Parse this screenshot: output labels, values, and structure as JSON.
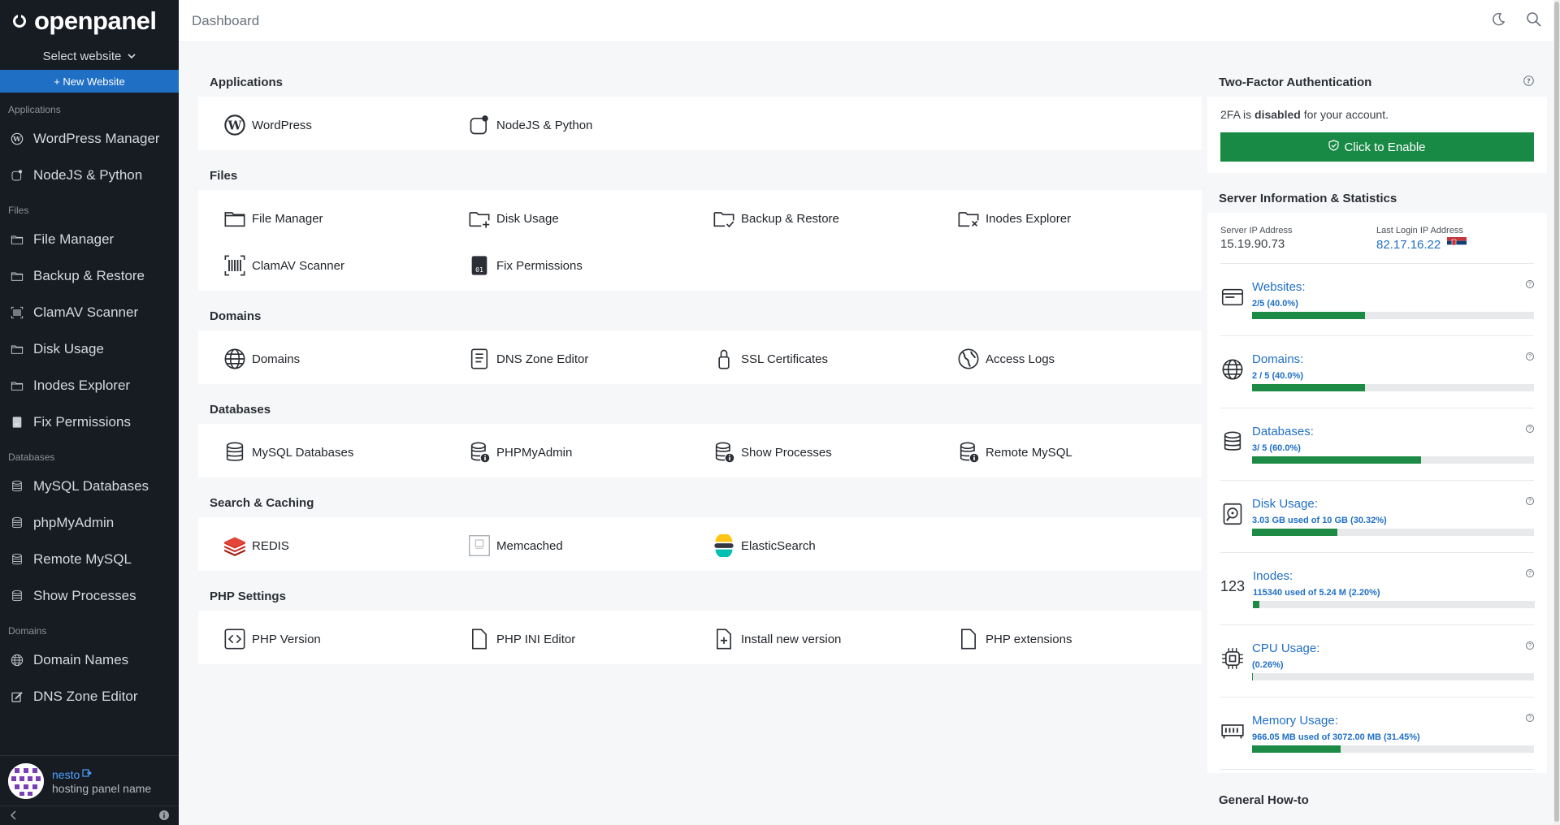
{
  "brand": {
    "logo_text": "openpanel"
  },
  "sidebar": {
    "select_website": "Select website",
    "new_website": "+ New Website",
    "sections": [
      {
        "title": "Applications",
        "items": [
          {
            "label": "WordPress Manager",
            "icon": "wordpress-icon"
          },
          {
            "label": "NodeJS & Python",
            "icon": "nodejs-icon"
          }
        ]
      },
      {
        "title": "Files",
        "items": [
          {
            "label": "File Manager",
            "icon": "folder-icon"
          },
          {
            "label": "Backup & Restore",
            "icon": "folder-icon"
          },
          {
            "label": "ClamAV Scanner",
            "icon": "barcode-icon"
          },
          {
            "label": "Disk Usage",
            "icon": "folder-icon"
          },
          {
            "label": "Inodes Explorer",
            "icon": "folder-icon"
          },
          {
            "label": "Fix Permissions",
            "icon": "file-lock-icon"
          }
        ]
      },
      {
        "title": "Databases",
        "items": [
          {
            "label": "MySQL Databases",
            "icon": "database-icon"
          },
          {
            "label": "phpMyAdmin",
            "icon": "database-icon"
          },
          {
            "label": "Remote MySQL",
            "icon": "database-icon"
          },
          {
            "label": "Show Processes",
            "icon": "database-icon"
          }
        ]
      },
      {
        "title": "Domains",
        "items": [
          {
            "label": "Domain Names",
            "icon": "globe-icon"
          },
          {
            "label": "DNS Zone Editor",
            "icon": "edit-icon"
          }
        ]
      }
    ],
    "user": {
      "name": "nesto",
      "subtitle": "hosting panel name"
    }
  },
  "header": {
    "breadcrumb": "Dashboard"
  },
  "main": {
    "sections": [
      {
        "title": "Applications",
        "items": [
          {
            "label": "WordPress",
            "icon": "wordpress-icon"
          },
          {
            "label": "NodeJS & Python",
            "icon": "nodejs-icon"
          }
        ]
      },
      {
        "title": "Files",
        "items": [
          {
            "label": "File Manager",
            "icon": "folder-icon"
          },
          {
            "label": "Disk Usage",
            "icon": "folder-plus-icon"
          },
          {
            "label": "Backup & Restore",
            "icon": "folder-check-icon"
          },
          {
            "label": "Inodes Explorer",
            "icon": "folder-x-icon"
          },
          {
            "label": "ClamAV Scanner",
            "icon": "barcode-scan-icon"
          },
          {
            "label": "Fix Permissions",
            "icon": "binary-file-icon"
          }
        ]
      },
      {
        "title": "Domains",
        "items": [
          {
            "label": "Domains",
            "icon": "globe-icon"
          },
          {
            "label": "DNS Zone Editor",
            "icon": "document-icon"
          },
          {
            "label": "SSL Certificates",
            "icon": "lock-icon"
          },
          {
            "label": "Access Logs",
            "icon": "globe-pin-icon"
          }
        ]
      },
      {
        "title": "Databases",
        "items": [
          {
            "label": "MySQL Databases",
            "icon": "database-icon"
          },
          {
            "label": "PHPMyAdmin",
            "icon": "database-info-icon"
          },
          {
            "label": "Show Processes",
            "icon": "database-off-icon"
          },
          {
            "label": "Remote MySQL",
            "icon": "database-remote-icon"
          }
        ]
      },
      {
        "title": "Search & Caching",
        "items": [
          {
            "label": "REDIS",
            "icon": "redis-icon"
          },
          {
            "label": "Memcached",
            "icon": "memcached-icon"
          },
          {
            "label": "ElasticSearch",
            "icon": "elasticsearch-icon"
          }
        ]
      },
      {
        "title": "PHP Settings",
        "items": [
          {
            "label": "PHP Version",
            "icon": "code-file-icon"
          },
          {
            "label": "PHP INI Editor",
            "icon": "file-icon"
          },
          {
            "label": "Install new version",
            "icon": "file-plus-icon"
          },
          {
            "label": "PHP extensions",
            "icon": "file-icon"
          }
        ]
      }
    ]
  },
  "tfa": {
    "title": "Two-Factor Authentication",
    "text_prefix": "2FA is ",
    "text_bold": "disabled",
    "text_suffix": " for your account.",
    "button": "Click to Enable"
  },
  "server": {
    "title": "Server Information & Statistics",
    "server_ip_label": "Server IP Address",
    "server_ip": "15.19.90.73",
    "last_login_label": "Last Login IP Address",
    "last_login_ip": "82.17.16.22",
    "stats": [
      {
        "label": "Websites:",
        "sub": "2/5 (40.0%)",
        "percent": 40.0,
        "icon": "browser-window-icon"
      },
      {
        "label": "Domains:",
        "sub": "2 / 5 (40.0%)",
        "percent": 40.0,
        "icon": "globe-icon"
      },
      {
        "label": "Databases:",
        "sub": "3/ 5 (60.0%)",
        "percent": 60.0,
        "icon": "database-icon"
      },
      {
        "label": "Disk Usage:",
        "sub": "3.03 GB used of 10 GB (30.32%)",
        "percent": 30.32,
        "icon": "hard-drive-icon"
      },
      {
        "label": "Inodes:",
        "sub": "115340 used of 5.24 M (2.20%)",
        "percent": 2.2,
        "icon": "inodes-number-icon",
        "icon_text": "123"
      },
      {
        "label": "CPU Usage:",
        "sub": "(0.26%)",
        "percent": 0.26,
        "icon": "cpu-icon"
      },
      {
        "label": "Memory Usage:",
        "sub": "966.05 MB used of 3072.00 MB (31.45%)",
        "percent": 31.45,
        "icon": "memory-icon"
      }
    ]
  },
  "howto": {
    "title": "General How-to"
  }
}
